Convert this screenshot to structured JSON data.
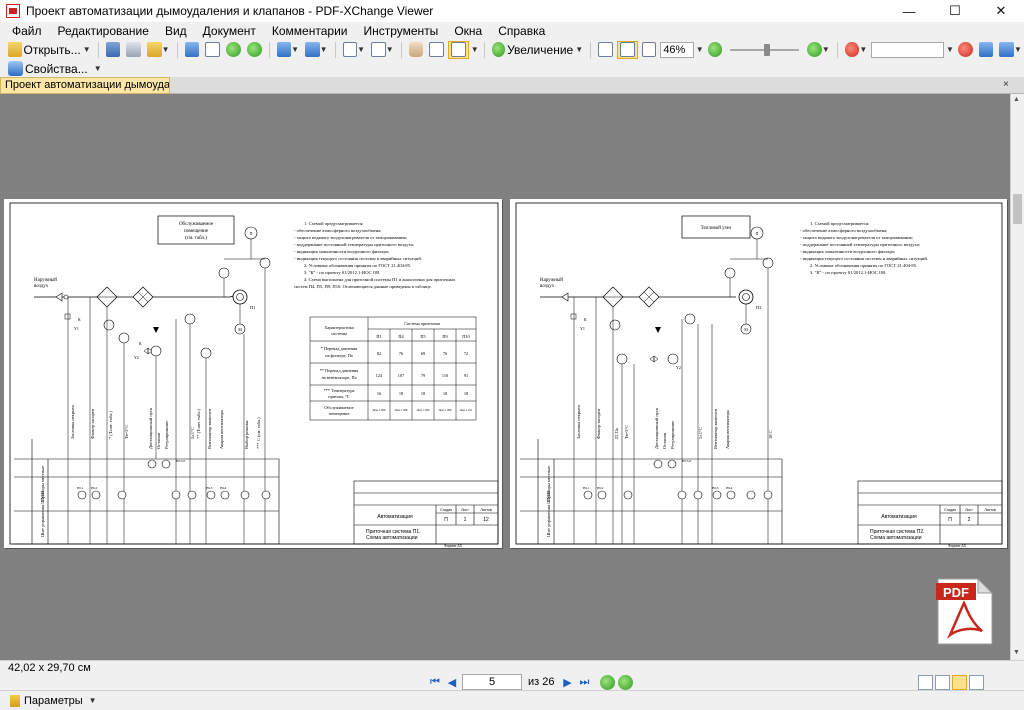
{
  "window": {
    "title": "Проект автоматизации дымоудаления и клапанов - PDF-XChange Viewer",
    "minimize": "—",
    "maximize": "☐",
    "close": "✕"
  },
  "menu": [
    "Файл",
    "Редактирование",
    "Вид",
    "Документ",
    "Комментарии",
    "Инструменты",
    "Окна",
    "Справка"
  ],
  "toolbar": {
    "open_label": "Открыть...",
    "zoom_label": "Увеличение",
    "zoom_value": "46%",
    "properties_label": "Свойства..."
  },
  "doc_tab": {
    "title": "Проект автоматизации дымоудаления и кл...",
    "close": "×"
  },
  "page_left": {
    "room_box": "Обслуживаемое помещение (см. табл.)",
    "outside_air": "Наружный воздух",
    "notes": [
      "1. Схемой предусматривается:",
      "- обеспечение атмосферного воздухообмена;",
      "- защита водяного воздухонагревателя от замораживания;",
      "- поддержание постоянной температуры приточного воздуха;",
      "- индикация запыленности воздушного фильтра;",
      "- индикация текущего состояния системы и аварийных ситуаций.",
      "2. Условные обозначения приняты по ГОСТ 21.404-85.",
      "3. \"К\" - по проекту 01/2012.1-ИОС ОВ.",
      "4. Схема выполнена для приточной системы П1 и аналогична для приточных систем П4, П5, П9, П10. Отличающиеся данные приведены в таблице."
    ],
    "table": {
      "header_left": "Характеристика системы",
      "header_group": "Система приточная",
      "columns": [
        "П1",
        "П4",
        "П5",
        "П9",
        "П10"
      ],
      "rows": [
        {
          "label": "* Перепад давления на фильтре, Па",
          "values": [
            "82",
            "76",
            "69",
            "76",
            "72"
          ]
        },
        {
          "label": "** Перепад давления на вентиляторе, Па",
          "values": [
            "124",
            "107",
            "79",
            "110",
            "91"
          ]
        },
        {
          "label": "*** Температура притока, °С",
          "values": [
            "16",
            "18",
            "18",
            "18",
            "18"
          ]
        },
        {
          "label": "Обслуживаемое помещение",
          "values": [
            "Пом. 1.006",
            "Пом. 1.008",
            "Пом. 1.006",
            "Пом. 1.008",
            "Пом. 1.011"
          ]
        }
      ]
    },
    "stamp": {
      "title": "Автоматизация",
      "stage_h": "Стадия",
      "sheet_h": "Лист",
      "sheets_h": "Листов",
      "stage": "П",
      "sheet": "1",
      "sheets": "12",
      "caption": "Приточная система П1. Схема автоматизации",
      "format": "Формат А3"
    },
    "panel_label": "Шит управления ШУП1",
    "local_label": "Приборы местные",
    "lamps": [
      "HL1",
      "HL2",
      "HL3",
      "HL4",
      "HL5,6"
    ]
  },
  "page_right": {
    "room_box": "Тепловой узел",
    "outside_air": "Наружный воздух",
    "notes": [
      "1. Схемой предусматривается:",
      "- обеспечение атмосферного воздухообмена;",
      "- защита водяного воздухонагревателя от замораживания;",
      "- поддержание постоянной температуры приточного воздуха;",
      "- индикация запыленности воздушного фильтра;",
      "- индикация текущего состояния системы и аварийных ситуаций.",
      "2. Условные обозначения приняты по ГОСТ 21.404-85.",
      "3. \"К\" - по проекту 01/2012.1-ИОС ОВ."
    ],
    "stamp": {
      "title": "Автоматизация",
      "stage_h": "Стадия",
      "sheet_h": "Лист",
      "sheets_h": "Листов",
      "stage": "П",
      "sheet": "2",
      "sheets": "",
      "caption": "Приточная система П2. Схема автоматизации",
      "format": "Формат А3"
    },
    "panel_label": "Шит управления ШУП2",
    "local_label": "Приборы местные"
  },
  "pdf_badge": "PDF",
  "status": {
    "page_size": "42,02 x 29,70 см",
    "current_page": "5",
    "of_text": "из 26",
    "params_label": "Параметры"
  },
  "colors": {
    "accent": "#ffe18a",
    "viewer_bg": "#808080",
    "pdf_red": "#c8281c"
  }
}
